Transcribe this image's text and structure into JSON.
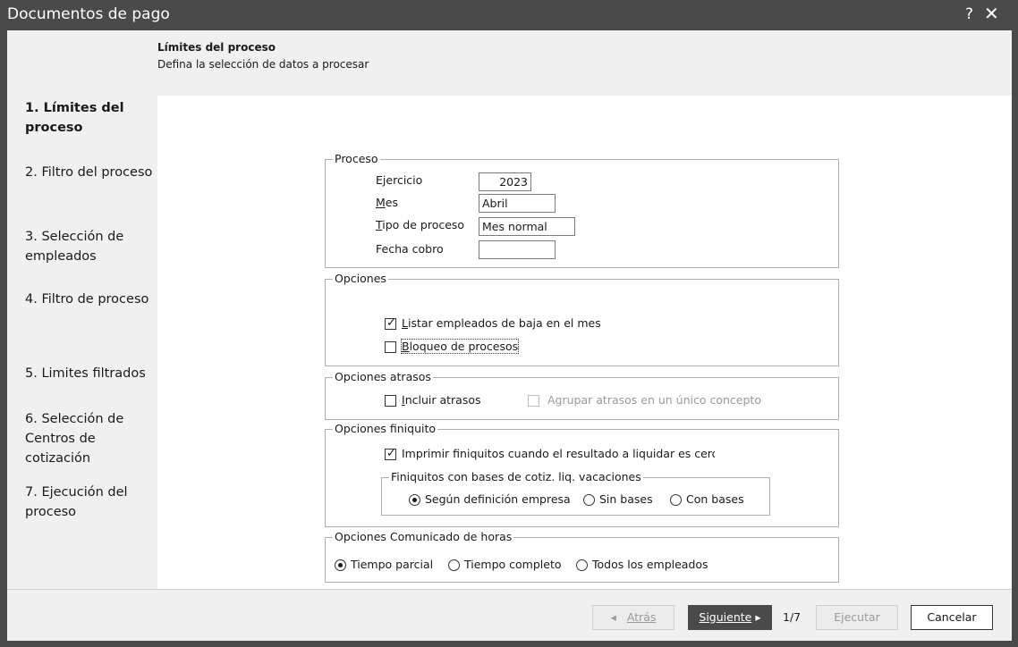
{
  "window": {
    "title": "Documentos de pago",
    "help": "?",
    "close": "✕"
  },
  "header": {
    "title": "Límites del proceso",
    "subtitle": "Defina la selección de datos a procesar"
  },
  "steps": [
    {
      "label": "1. Límites del proceso",
      "active": true
    },
    {
      "label": "2. Filtro del proceso"
    },
    {
      "label": "3. Selección de empleados"
    },
    {
      "label": "4. Filtro de proceso"
    },
    {
      "label": "5. Limites filtrados"
    },
    {
      "label": "6. Selección de Centros de cotización"
    },
    {
      "label": "7. Ejecución del proceso"
    }
  ],
  "proceso": {
    "legend": "Proceso",
    "ejercicio_label": "Ejercicio",
    "ejercicio_value": "2023",
    "mes_label": "Mes",
    "mes_value": "Abril",
    "tipo_label": "Tipo de proceso",
    "tipo_value": "Mes normal",
    "fecha_label": "Fecha cobro",
    "fecha_value": ""
  },
  "opciones": {
    "legend": "Opciones",
    "listar_label": "Listar empleados de baja en el mes",
    "listar_checked": true,
    "bloqueo_label": "Bloqueo de procesos",
    "bloqueo_checked": false
  },
  "atrasos": {
    "legend": "Opciones atrasos",
    "incluir_label": "Incluir atrasos",
    "agrupar_label": "Agrupar atrasos en un único concepto"
  },
  "finiquito": {
    "legend": "Opciones finiquito",
    "imprimir_label": "Imprimir finiquitos cuando el resultado a liquidar es cero",
    "bases_legend": "Finiquitos con bases de cotiz. liq. vacaciones",
    "radios": [
      "Según definición empresa",
      "Sin bases",
      "Con bases"
    ],
    "selected": "Según definición empresa"
  },
  "horas": {
    "legend": "Opciones Comunicado de horas",
    "radios": [
      "Tiempo parcial",
      "Tiempo completo",
      "Todos los empleados"
    ],
    "selected": "Tiempo parcial"
  },
  "footer": {
    "atras": "Atrás",
    "siguiente": "Siguiente",
    "page": "1/7",
    "ejecutar": "Ejecutar",
    "cancelar": "Cancelar"
  }
}
